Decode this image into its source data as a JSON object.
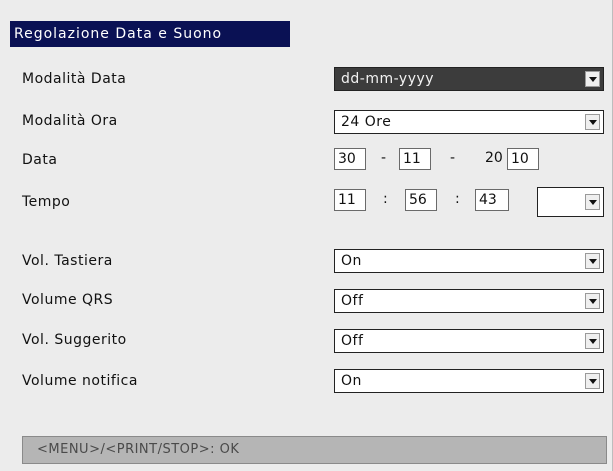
{
  "window": {
    "title": "Regolazione Data e Suono"
  },
  "fields": {
    "date_mode": {
      "label": "Modalità Data",
      "value": "dd-mm-yyyy"
    },
    "time_mode": {
      "label": "Modalità Ora",
      "value": "24 Ore"
    },
    "date": {
      "label": "Data",
      "day": "30",
      "month": "11",
      "year_prefix": "20",
      "year_suffix": "10",
      "separator": "-"
    },
    "time": {
      "label": "Tempo",
      "hours": "11",
      "minutes": "56",
      "seconds": "43",
      "separator": ":",
      "ampm": ""
    },
    "keyboard_volume": {
      "label": "Vol. Tastiera",
      "value": "On"
    },
    "qrs_volume": {
      "label": "Volume QRS",
      "value": "Off"
    },
    "hint_volume": {
      "label": "Vol. Suggerito",
      "value": "Off"
    },
    "notify_volume": {
      "label": "Volume notifica",
      "value": "On"
    }
  },
  "status_bar": {
    "text": "<MENU>/<PRINT/STOP>: OK"
  },
  "icons": {
    "dropdown_arrow": "chevron-down-icon"
  },
  "colors": {
    "titlebar_bg": "#0a1154",
    "selected_field_bg": "#3c3c3c",
    "status_bg": "#b5b5b5"
  }
}
